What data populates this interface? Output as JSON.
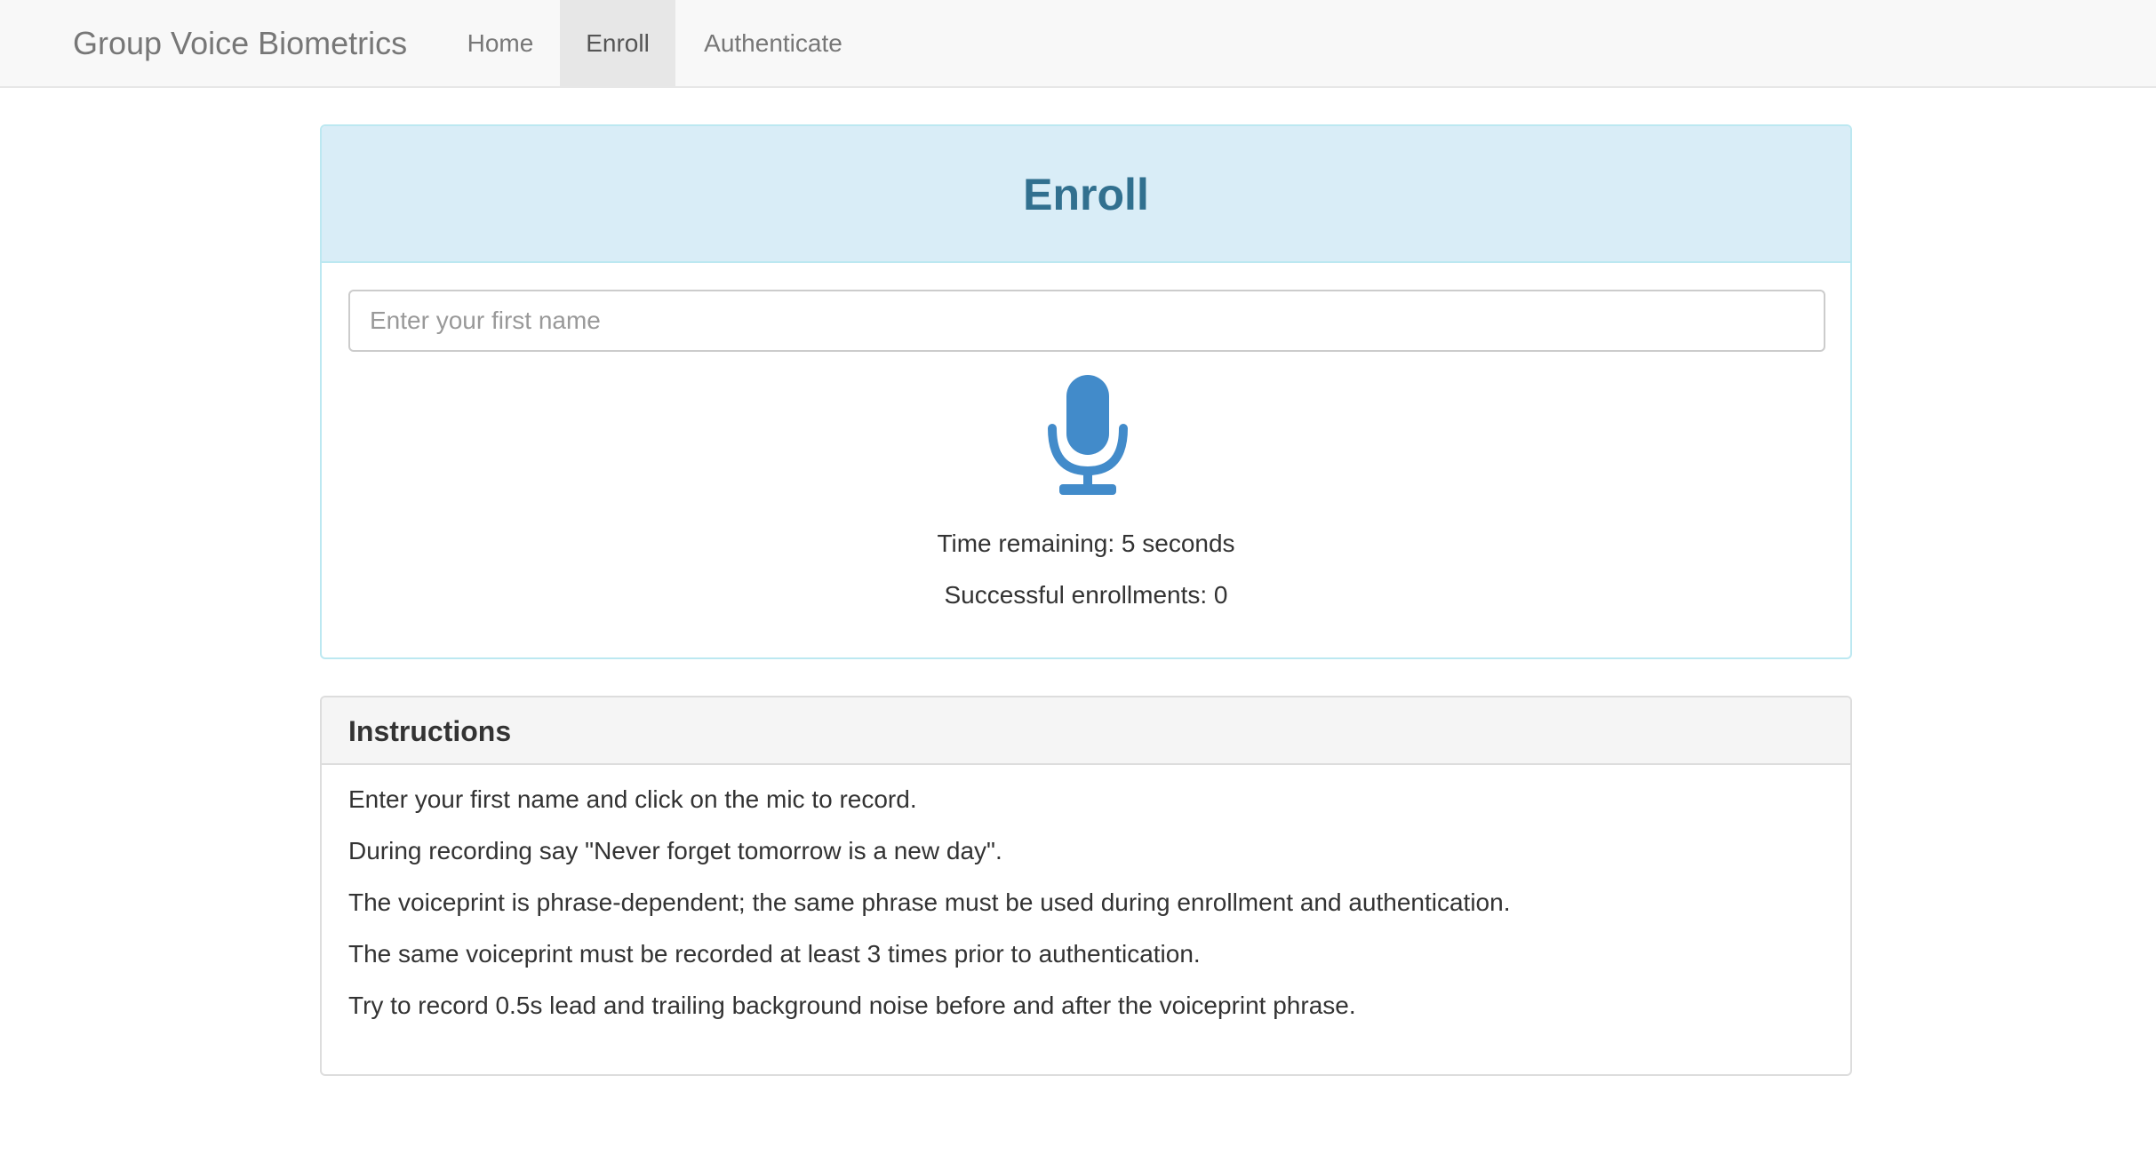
{
  "navbar": {
    "brand": "Group Voice Biometrics",
    "items": [
      {
        "label": "Home",
        "active": false
      },
      {
        "label": "Enroll",
        "active": true
      },
      {
        "label": "Authenticate",
        "active": false
      }
    ]
  },
  "enroll_panel": {
    "title": "Enroll",
    "name_input": {
      "value": "",
      "placeholder": "Enter your first name"
    },
    "mic_icon": "microphone-icon",
    "time_remaining": "Time remaining: 5 seconds",
    "successful_enrollments": "Successful enrollments: 0"
  },
  "instructions_panel": {
    "title": "Instructions",
    "lines": [
      "Enter your first name and click on the mic to record.",
      "During recording say \"Never forget tomorrow is a new day\".",
      "The voiceprint is phrase-dependent; the same phrase must be used during enrollment and authentication.",
      "The same voiceprint must be recorded at least 3 times prior to authentication.",
      "Try to record 0.5s lead and trailing background noise before and after the voiceprint phrase."
    ]
  },
  "colors": {
    "navbar_bg": "#f8f8f8",
    "panel_info_heading_bg": "#d9edf7",
    "panel_info_heading_text": "#31708f",
    "mic_blue": "#428bca"
  }
}
